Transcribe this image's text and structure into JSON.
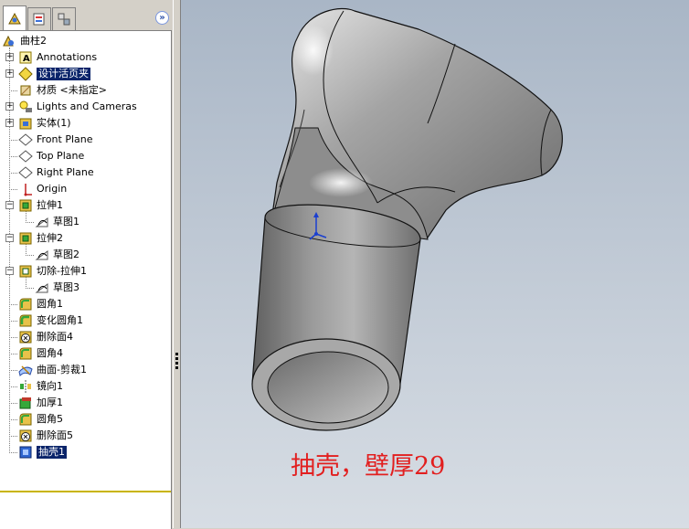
{
  "tabs": [
    {
      "name": "feature-manager",
      "icon": "feature-manager-icon"
    },
    {
      "name": "property-manager",
      "icon": "property-manager-icon"
    },
    {
      "name": "configuration-manager",
      "icon": "configuration-manager-icon"
    }
  ],
  "expand_label": "»",
  "tree": {
    "root": "曲柱2",
    "items": [
      {
        "label": "Annotations",
        "icon": "annotations-icon",
        "expander": "+"
      },
      {
        "label": "设计活页夹",
        "icon": "design-binder-icon",
        "expander": "+",
        "selected": true
      },
      {
        "label": "材质 <未指定>",
        "icon": "material-icon",
        "expander": ""
      },
      {
        "label": "Lights and Cameras",
        "icon": "lights-cameras-icon",
        "expander": "+"
      },
      {
        "label": "实体(1)",
        "icon": "solid-bodies-icon",
        "expander": "+"
      },
      {
        "label": "Front Plane",
        "icon": "plane-icon",
        "expander": ""
      },
      {
        "label": "Top Plane",
        "icon": "plane-icon",
        "expander": ""
      },
      {
        "label": "Right Plane",
        "icon": "plane-icon",
        "expander": ""
      },
      {
        "label": "Origin",
        "icon": "origin-icon",
        "expander": ""
      },
      {
        "label": "拉伸1",
        "icon": "extrude-icon",
        "expander": "-"
      },
      {
        "label": "草图1",
        "icon": "sketch-icon",
        "expander": "",
        "child": true
      },
      {
        "label": "拉伸2",
        "icon": "extrude-icon",
        "expander": "-"
      },
      {
        "label": "草图2",
        "icon": "sketch-icon",
        "expander": "",
        "child": true
      },
      {
        "label": "切除-拉伸1",
        "icon": "cut-extrude-icon",
        "expander": "-"
      },
      {
        "label": "草图3",
        "icon": "sketch-icon",
        "expander": "",
        "child": true
      },
      {
        "label": "圆角1",
        "icon": "fillet-icon",
        "expander": ""
      },
      {
        "label": "变化圆角1",
        "icon": "variable-fillet-icon",
        "expander": ""
      },
      {
        "label": "删除面4",
        "icon": "delete-face-icon",
        "expander": ""
      },
      {
        "label": "圆角4",
        "icon": "fillet-icon",
        "expander": ""
      },
      {
        "label": "曲面-剪裁1",
        "icon": "surface-trim-icon",
        "expander": ""
      },
      {
        "label": "镜向1",
        "icon": "mirror-icon",
        "expander": ""
      },
      {
        "label": "加厚1",
        "icon": "thicken-icon",
        "expander": ""
      },
      {
        "label": "圆角5",
        "icon": "fillet-icon",
        "expander": ""
      },
      {
        "label": "删除面5",
        "icon": "delete-face-icon",
        "expander": ""
      },
      {
        "label": "抽壳1",
        "icon": "shell-icon",
        "expander": "",
        "selected": true
      }
    ]
  },
  "viewport": {
    "caption": "抽壳，壁厚29",
    "caption_color": "#e21f1f",
    "model": "curved-handle-shell-model",
    "triad": "coordinate-triad-icon"
  }
}
